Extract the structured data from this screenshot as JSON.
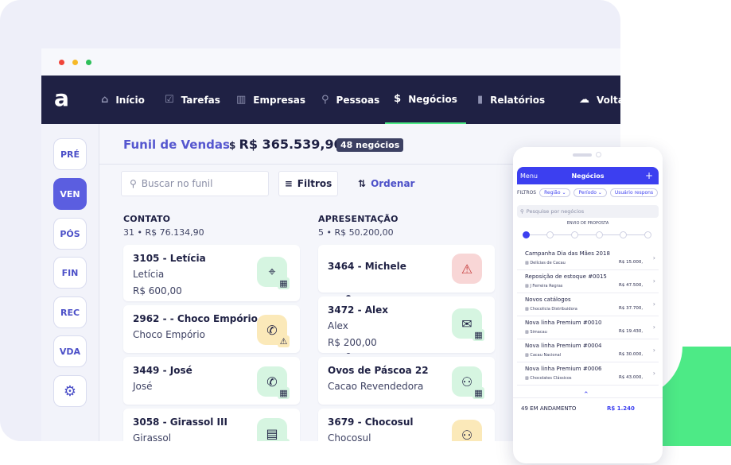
{
  "colors": {
    "brand": "#1f2144",
    "accent": "#5b5ee0",
    "green": "#4dea86"
  },
  "nav": {
    "logo": "a",
    "items": [
      {
        "label": "Início",
        "icon": "home-icon"
      },
      {
        "label": "Tarefas",
        "icon": "check-square-icon"
      },
      {
        "label": "Empresas",
        "icon": "building-icon"
      },
      {
        "label": "Pessoas",
        "icon": "person-icon"
      },
      {
        "label": "Negócios",
        "icon": "dollar-cycle-icon"
      },
      {
        "label": "Relatórios",
        "icon": "bar-chart-icon"
      },
      {
        "label": "Volta",
        "icon": "cloud-return-icon"
      }
    ]
  },
  "sidebar": {
    "items": [
      "PRÉ",
      "VEN",
      "PÓS",
      "FIN",
      "REC",
      "VDA"
    ],
    "active": "VEN"
  },
  "header": {
    "title": "Funil de Vendas",
    "total": "R$ 365.539,90",
    "badge": "48 negócios"
  },
  "toolbar": {
    "search_placeholder": "Buscar no funil",
    "filter_label": "Filtros",
    "sort_label": "Ordenar"
  },
  "columns": [
    {
      "title": "CONTATO",
      "summary": "31 • R$ 76.134,90",
      "cards": [
        {
          "title": "3105 - Letícia",
          "line1": "Letícia",
          "line2": "R$ 600,00",
          "icon": "location-pin-icon",
          "sub": "calendar-icon"
        },
        {
          "title": "2962 - - Choco Empório",
          "line1": "Choco Empório",
          "line2": "",
          "icon": "phone-call-icon",
          "sub": "warning-icon"
        },
        {
          "title": "3449 - José",
          "line1": "José",
          "line2": "",
          "icon": "phone-call-icon",
          "sub": "calendar-icon"
        },
        {
          "title": "3058 - Girassol III",
          "line1": "Girassol",
          "line2": "",
          "icon": "document-icon",
          "sub": "calendar-icon"
        }
      ]
    },
    {
      "title": "APRESENTAÇÃO",
      "summary": "5 • R$ 50.200,00",
      "cards": [
        {
          "title": "3464 - Michele",
          "line1": "",
          "line2": "",
          "icon": "alert-triangle-icon",
          "sub": ""
        },
        {
          "title": "3472 - Alex",
          "line1": "Alex",
          "line2": "R$ 200,00",
          "icon": "mail-icon",
          "sub": "calendar-icon"
        },
        {
          "title": "Ovos de Páscoa 22",
          "line1": "Cacao Revendedora",
          "line2": "",
          "icon": "people-icon",
          "sub": "calendar-icon"
        },
        {
          "title": "3679 - Chocosul",
          "line1": "Chocosul",
          "line2": "",
          "icon": "people-icon",
          "sub": ""
        }
      ]
    }
  ],
  "phone": {
    "menu": "Menu",
    "title": "Negócios",
    "plus": "+",
    "filters_label": "FILTROS",
    "chips": [
      "Região",
      "Período",
      "Usuário respons"
    ],
    "search_placeholder": "Pesquise por negócios",
    "stage": "ENVIO DE PROPOSTA",
    "rows": [
      {
        "title": "Campanha Dia das Mães 2018",
        "company": "Delícias de Cacau",
        "value": "R$ 15.000,"
      },
      {
        "title": "Reposição de estoque #0015",
        "company": "J Ferreira Regras",
        "value": "R$ 47.500,"
      },
      {
        "title": "Novos catálogos",
        "company": "Chocolicia Distribuidora",
        "value": "R$ 37.700,"
      },
      {
        "title": "Nova linha Premium #0010",
        "company": "Simacau",
        "value": "R$ 19.430,"
      },
      {
        "title": "Nova linha Premium #0004",
        "company": "Cacau Nacional",
        "value": "R$ 30.000,"
      },
      {
        "title": "Nova linha Premium #0006",
        "company": "Chocolates Clássicos",
        "value": "R$ 43.000,"
      }
    ],
    "footer_count": "49 EM ANDAMENTO",
    "footer_value": "R$ 1.240"
  }
}
